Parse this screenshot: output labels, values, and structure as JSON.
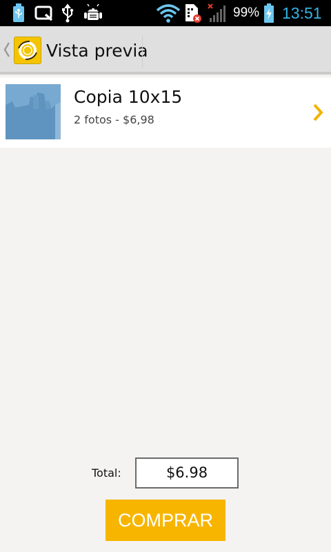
{
  "status_bar": {
    "battery_percent": "99%",
    "battery_level": 0.99,
    "time": "13:51",
    "icons": [
      "usb-storage-icon",
      "q-app-icon",
      "usb-icon",
      "android-debug-icon",
      "wifi-icon",
      "sim-error-icon",
      "no-signal-icon",
      "battery-charging-icon"
    ],
    "time_color": "#35b4e6"
  },
  "action_bar": {
    "title": "Vista previa",
    "logo_color": "#f5c400"
  },
  "list": {
    "items": [
      {
        "title": "Copia 10x15",
        "subtitle": "2 fotos - $6,98"
      }
    ]
  },
  "footer": {
    "total_label": "Total:",
    "total_value": "$6.98",
    "buy_label": "COMPRAR",
    "accent_color": "#f7b500"
  }
}
